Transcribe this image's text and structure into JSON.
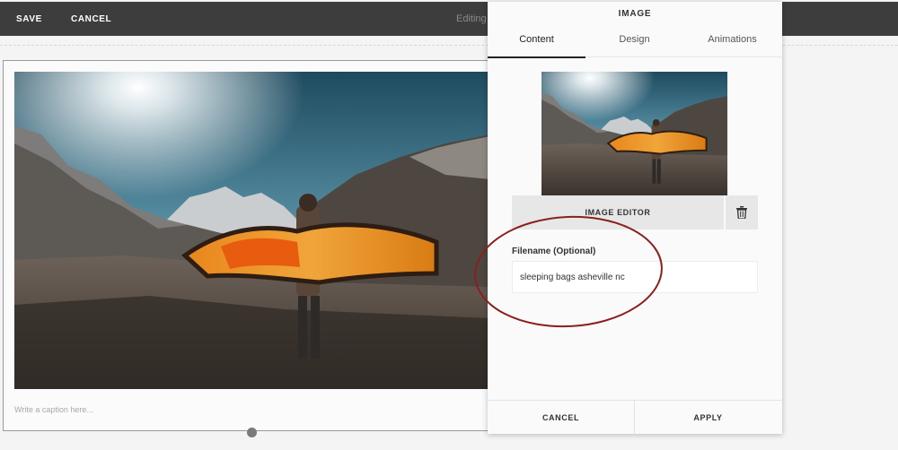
{
  "toolbar": {
    "save_label": "SAVE",
    "cancel_label": "CANCEL",
    "editing_label": "Editing"
  },
  "editor": {
    "caption_placeholder": "Write a caption here..."
  },
  "panel": {
    "title": "IMAGE",
    "tabs": [
      {
        "label": "Content",
        "active": true
      },
      {
        "label": "Design",
        "active": false
      },
      {
        "label": "Animations",
        "active": false
      }
    ],
    "image_editor_label": "IMAGE EDITOR",
    "delete_icon": "trash-icon",
    "filename_label": "Filename (Optional)",
    "filename_value": "sleeping bags asheville nc",
    "cancel_label": "CANCEL",
    "apply_label": "APPLY"
  },
  "annotation": {
    "circle_color": "#8b1f1f"
  }
}
